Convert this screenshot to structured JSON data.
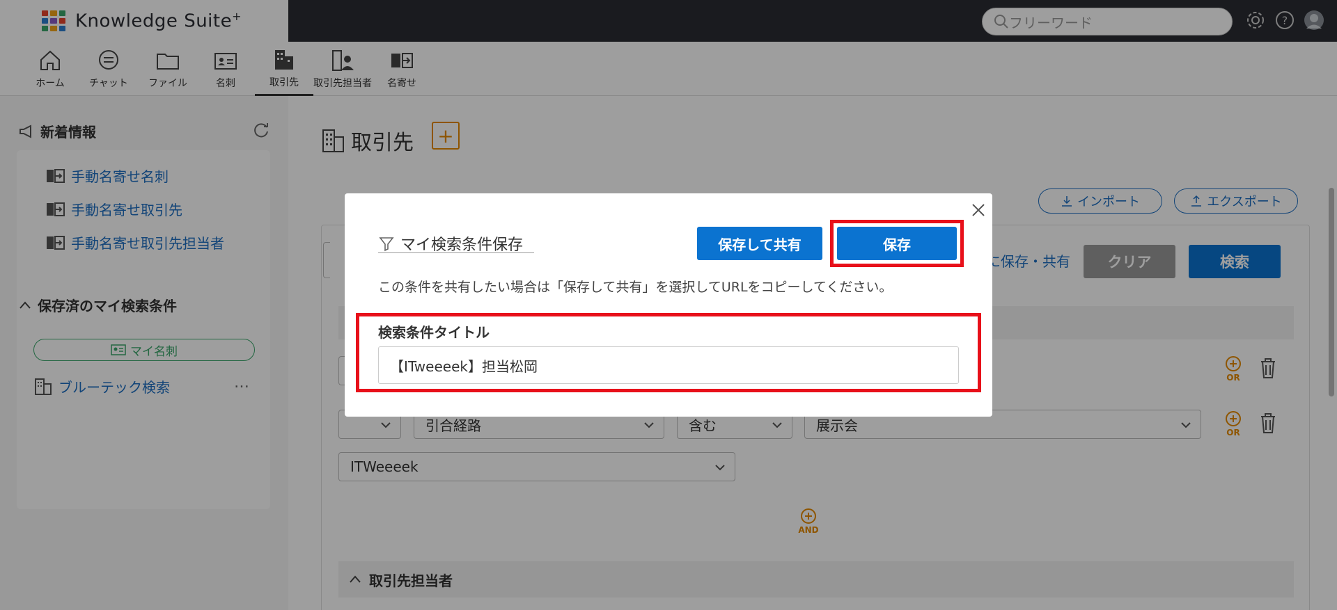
{
  "app": {
    "name": "Knowledge Suite",
    "name_sup": "+"
  },
  "header": {
    "search_placeholder": "フリーワード",
    "icons": [
      "gear-icon",
      "help-icon",
      "avatar"
    ]
  },
  "nav": {
    "items": [
      {
        "label": "ホーム",
        "icon": "home-icon"
      },
      {
        "label": "チャット",
        "icon": "chat-icon"
      },
      {
        "label": "ファイル",
        "icon": "folder-icon"
      },
      {
        "label": "名刺",
        "icon": "business-card-icon"
      },
      {
        "label": "取引先",
        "icon": "building-icon",
        "active": true
      },
      {
        "label": "取引先担当者",
        "icon": "contact-person-icon"
      },
      {
        "label": "名寄せ",
        "icon": "merge-icon"
      }
    ]
  },
  "sidebar": {
    "news_title": "新着情報",
    "news_links": [
      "手動名寄せ名刺",
      "手動名寄せ取引先",
      "手動名寄せ取引先担当者"
    ],
    "saved_title": "保存済のマイ検索条件",
    "my_card_button": "マイ名刺",
    "saved_items": [
      {
        "label": "ブルーテック検索",
        "more": "…"
      }
    ]
  },
  "main": {
    "page_title": "取引先",
    "add_label": "+",
    "import_label": "インポート",
    "export_label": "エクスポート",
    "save_share_link": "に保存・共有",
    "clear_label": "クリア",
    "search_label": "検索",
    "filter_row2": {
      "field": "引合経路",
      "op": "含む",
      "value": "展示会"
    },
    "filter_row3": {
      "value": "ITWeeeek"
    },
    "or_label": "OR",
    "and_label": "AND",
    "section_contacts": "取引先担当者"
  },
  "modal": {
    "title": "マイ検索条件保存",
    "save_share_button": "保存して共有",
    "save_button": "保存",
    "description": "この条件を共有したい場合は「保存して共有」を選択してURLをコピーしてください。",
    "field_label": "検索条件タイトル",
    "field_value": "【ITweeeek】担当松岡"
  },
  "colors": {
    "primary": "#0b73d0",
    "highlight": "#e8101a",
    "accent_orange": "#e68a00",
    "topbar": "#2a2d33",
    "link": "#1d6fc2",
    "green": "#3aa66b"
  }
}
